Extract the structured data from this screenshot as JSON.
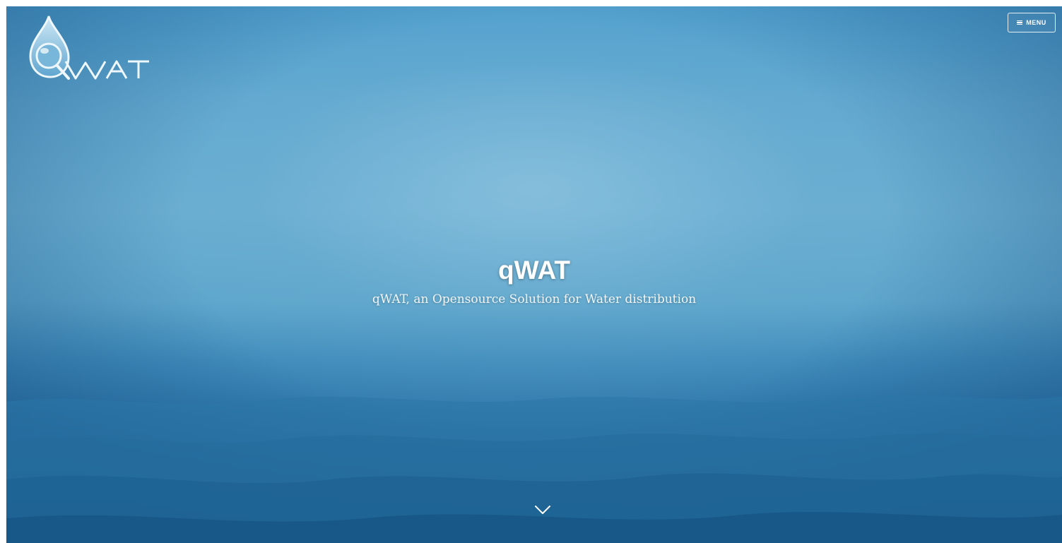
{
  "header": {
    "logo_text": "QWAT",
    "menu_label": "MENU",
    "menu_icon": "hamburger-icon"
  },
  "hero": {
    "title": "qWAT",
    "subtitle": "qWAT, an Opensource Solution for Water distribution",
    "scroll_icon": "chevron-down-icon"
  },
  "colors": {
    "accent": "#4f9fce",
    "deep": "#1f5f8c",
    "text": "#ffffff"
  }
}
